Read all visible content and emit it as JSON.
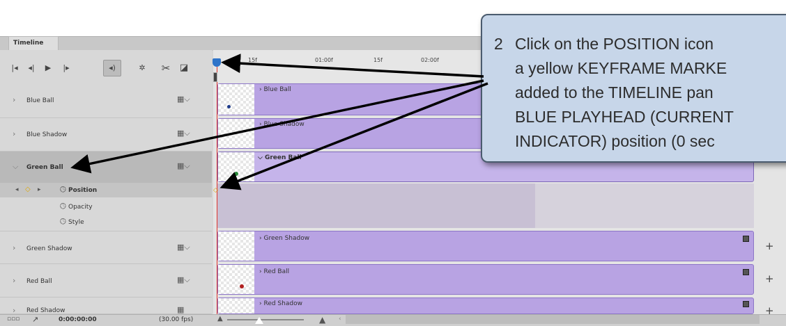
{
  "panel": {
    "tab_label": "Timeline",
    "timecode": "0:00:00:00",
    "fps": "(30.00 fps)"
  },
  "ruler": {
    "ticks": [
      "15f",
      "01:00f",
      "15f",
      "02:00f"
    ]
  },
  "layers": [
    {
      "name": "Blue Ball"
    },
    {
      "name": "Blue Shadow"
    },
    {
      "name": "Green Ball"
    },
    {
      "name": "Green Shadow"
    },
    {
      "name": "Red Ball"
    },
    {
      "name": "Red Shadow"
    }
  ],
  "properties": [
    "Position",
    "Opacity",
    "Style"
  ],
  "callout": {
    "number": "2",
    "lines": [
      "Click on the POSITION icon",
      "a yellow KEYFRAME MARKE",
      "added to the TIMELINE pan",
      "BLUE PLAYHEAD (CURRENT",
      "INDICATOR) position (0 sec"
    ]
  },
  "colors": {
    "clip": "#b8a3e3",
    "playhead": "#e0322a",
    "keyframe": "#f2c21a",
    "callout_bg": "#c7d6e9"
  },
  "icons": [
    "first-frame-icon",
    "prev-frame-icon",
    "play-icon",
    "next-frame-icon",
    "audio-icon",
    "settings-icon",
    "split-icon",
    "transition-icon",
    "film-icon",
    "stopwatch-icon",
    "diamond-keyframe-icon",
    "plus-icon"
  ]
}
